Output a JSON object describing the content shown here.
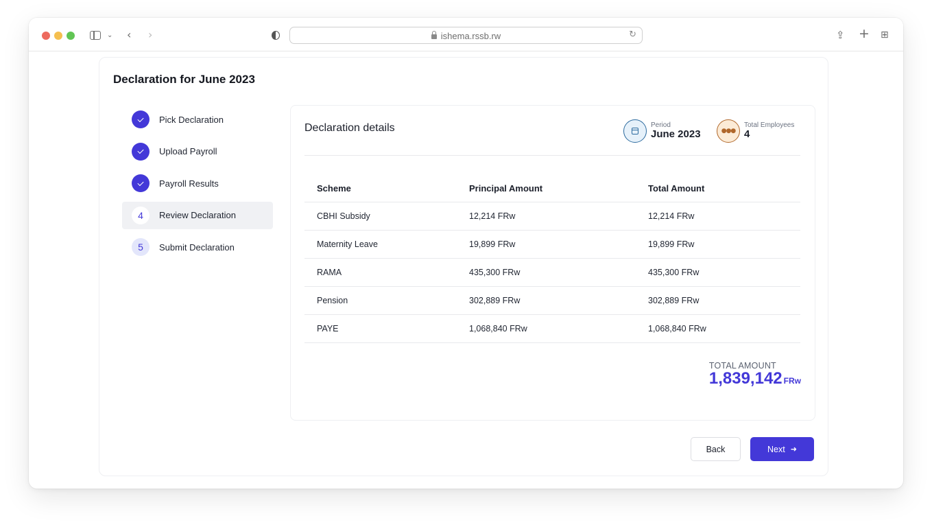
{
  "browser": {
    "url": "ishema.rssb.rw",
    "icons": [
      "sidebar-toggle-icon",
      "chevron-down-icon",
      "back-icon",
      "forward-icon",
      "shield-icon",
      "lock-icon",
      "reload-icon",
      "share-icon",
      "new-tab-icon",
      "tabs-overview-icon"
    ]
  },
  "page": {
    "title": "Declaration for June 2023"
  },
  "steps": [
    {
      "number": "1",
      "label": "Pick Declaration",
      "state": "done"
    },
    {
      "number": "2",
      "label": "Upload Payroll",
      "state": "done"
    },
    {
      "number": "3",
      "label": "Payroll Results",
      "state": "done"
    },
    {
      "number": "4",
      "label": "Review Declaration",
      "state": "current"
    },
    {
      "number": "5",
      "label": "Submit Declaration",
      "state": "pending"
    }
  ],
  "details": {
    "title": "Declaration details",
    "period_label": "Period",
    "period_value": "June 2023",
    "employees_label": "Total Employees",
    "employees_value": "4"
  },
  "table": {
    "headers": [
      "Scheme",
      "Principal Amount",
      "Total Amount"
    ],
    "rows": [
      [
        "CBHI Subsidy",
        "12,214 FRw",
        "12,214 FRw"
      ],
      [
        "Maternity Leave",
        "19,899 FRw",
        "19,899 FRw"
      ],
      [
        "RAMA",
        "435,300 FRw",
        "435,300 FRw"
      ],
      [
        "Pension",
        "302,889 FRw",
        "302,889 FRw"
      ],
      [
        "PAYE",
        "1,068,840 FRw",
        "1,068,840 FRw"
      ]
    ]
  },
  "total": {
    "label": "TOTAL AMOUNT",
    "value": "1,839,142",
    "unit": "FRw"
  },
  "actions": {
    "back_label": "Back",
    "next_label": "Next"
  },
  "colors": {
    "accent": "#4338d8",
    "period_icon": "#2b6a9e",
    "employees_icon": "#b0672a"
  }
}
